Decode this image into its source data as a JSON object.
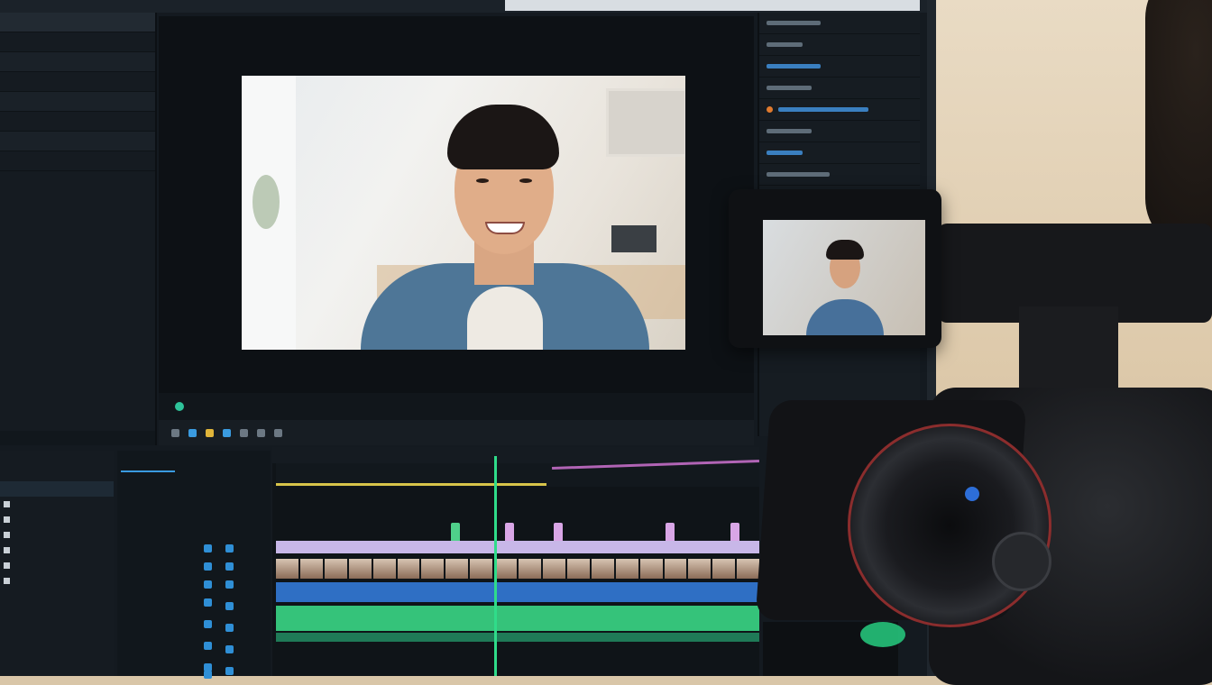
{
  "scene": {
    "description_colors": {
      "accent_blue": "#2f8fd6",
      "playhead_green": "#2fdc8a",
      "clip_green": "#35c37a",
      "clip_blue": "#2f6fc4",
      "clip_lavender": "#c8b7e8"
    },
    "icons": [
      "camera-icon",
      "play-icon",
      "gear-icon"
    ]
  }
}
